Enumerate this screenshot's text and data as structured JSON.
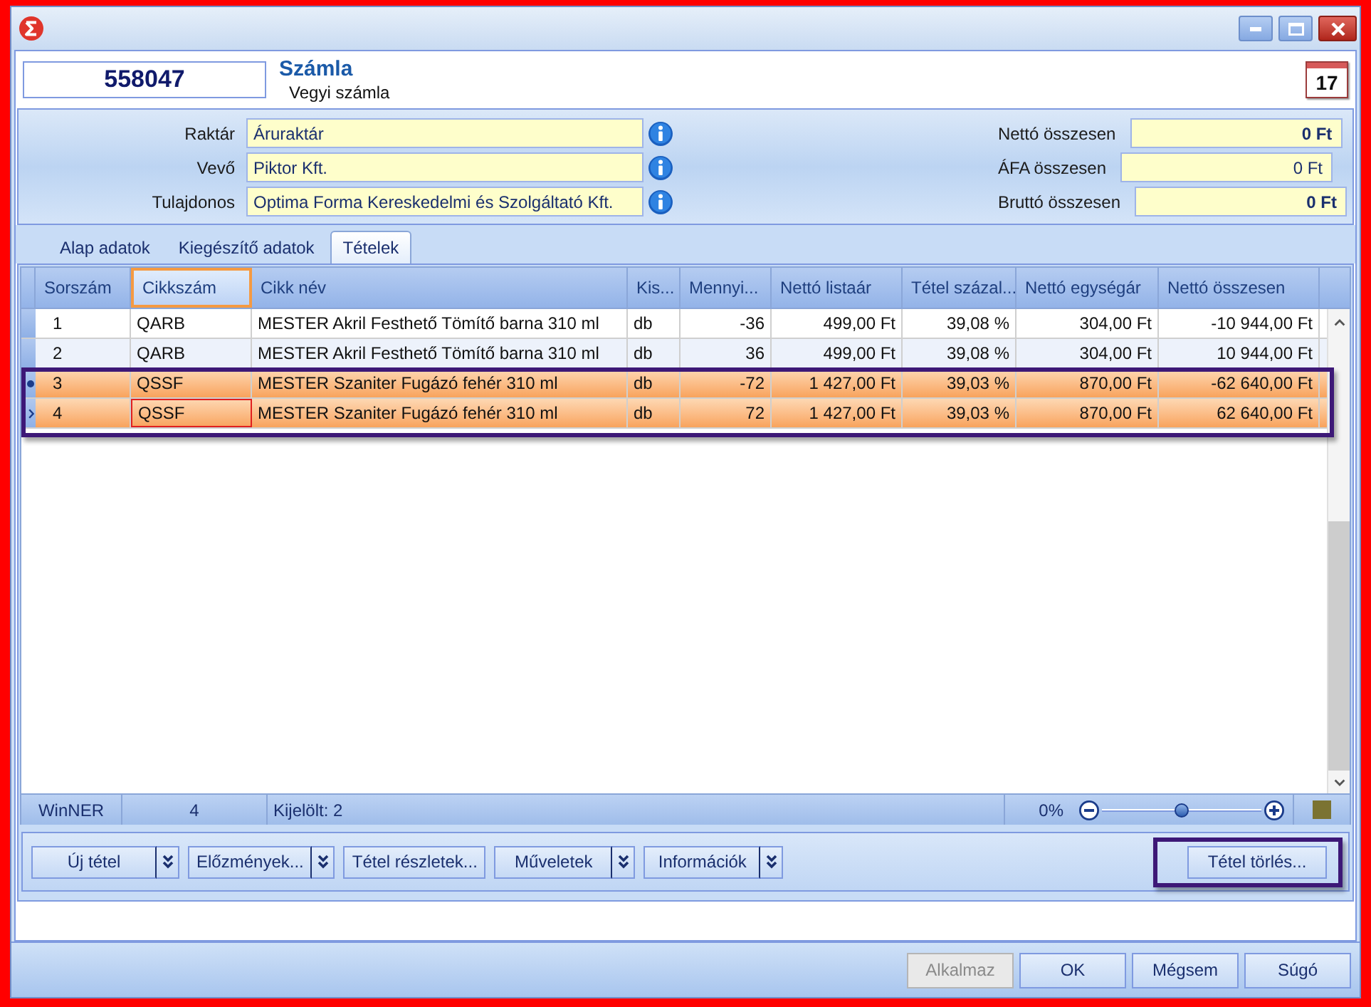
{
  "header": {
    "number": "558047",
    "title": "Számla",
    "subtitle": "Vegyi számla",
    "calendar_day": "17"
  },
  "fields": [
    {
      "label": "Raktár",
      "value": "Áruraktár"
    },
    {
      "label": "Vevő",
      "value": "Piktor Kft."
    },
    {
      "label": "Tulajdonos",
      "value": "Optima Forma Kereskedelmi és Szolgáltató Kft."
    }
  ],
  "totals": [
    {
      "label": "Nettó összesen",
      "value": "0 Ft",
      "bold": true
    },
    {
      "label": "ÁFA összesen",
      "value": "0 Ft",
      "bold": false
    },
    {
      "label": "Bruttó összesen",
      "value": "0 Ft",
      "bold": true
    }
  ],
  "tabs": [
    {
      "label": "Alap adatok",
      "selected": false
    },
    {
      "label": "Kiegészítő adatok",
      "selected": false
    },
    {
      "label": "Tételek",
      "selected": true
    }
  ],
  "table": {
    "columns": [
      {
        "label": "Sorszám",
        "selected": false
      },
      {
        "label": "Cikkszám",
        "selected": true
      },
      {
        "label": "Cikk név",
        "selected": false
      },
      {
        "label": "Kis...",
        "selected": false
      },
      {
        "label": "Mennyi...",
        "selected": false
      },
      {
        "label": "Nettó listaár",
        "selected": false
      },
      {
        "label": "Tétel százal...",
        "selected": false
      },
      {
        "label": "Nettó egységár",
        "selected": false
      },
      {
        "label": "Nettó összesen",
        "selected": false
      }
    ],
    "rows": [
      {
        "cells": [
          "1",
          "QARB",
          "MESTER Akril Festhető Tömítő barna 310 ml",
          "db",
          "-36",
          "499,00 Ft",
          "39,08 %",
          "304,00 Ft",
          "-10 944,00 Ft"
        ],
        "selected": false,
        "current": false,
        "marked": false
      },
      {
        "cells": [
          "2",
          "QARB",
          "MESTER Akril Festhető Tömítő barna 310 ml",
          "db",
          "36",
          "499,00 Ft",
          "39,08 %",
          "304,00 Ft",
          "10 944,00 Ft"
        ],
        "selected": false,
        "current": false,
        "marked": false
      },
      {
        "cells": [
          "3",
          "QSSF",
          "MESTER Szaniter Fugázó fehér 310 ml",
          "db",
          "-72",
          "1 427,00 Ft",
          "39,03 %",
          "870,00 Ft",
          "-62 640,00 Ft"
        ],
        "selected": true,
        "current": false,
        "marked": true
      },
      {
        "cells": [
          "4",
          "QSSF",
          "MESTER Szaniter Fugázó fehér 310 ml",
          "db",
          "72",
          "1 427,00 Ft",
          "39,03 %",
          "870,00 Ft",
          "62 640,00 Ft"
        ],
        "selected": true,
        "current": true,
        "marked": false
      }
    ]
  },
  "status_bar": {
    "app": "WinNER",
    "count": "4",
    "selection": "Kijelölt: 2",
    "zoom": {
      "reading": "0%",
      "level": 0.5
    }
  },
  "toolbar": {
    "buttons": [
      {
        "label": "Új tétel",
        "dropdown": true
      },
      {
        "label": "Előzmények...",
        "dropdown": true
      },
      {
        "label": "Tétel részletek...",
        "dropdown": false
      },
      {
        "label": "Műveletek",
        "dropdown": true
      },
      {
        "label": "Információk",
        "dropdown": true
      }
    ],
    "delete_button": {
      "label": "Tétel törlés...",
      "highlighted": true
    }
  },
  "dialog_buttons": [
    {
      "label": "Alkalmaz",
      "disabled": true
    },
    {
      "label": "OK",
      "disabled": false
    },
    {
      "label": "Mégsem",
      "disabled": false
    },
    {
      "label": "Súgó",
      "disabled": false
    }
  ]
}
